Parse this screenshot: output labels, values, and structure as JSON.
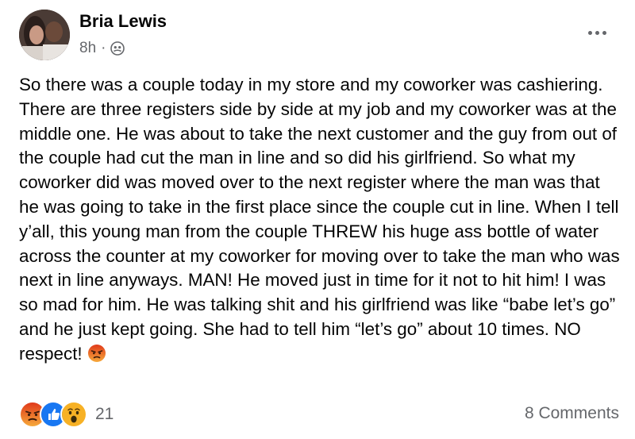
{
  "post": {
    "author": "Bria Lewis",
    "time": "8h",
    "separator": "·",
    "audience_icon": "friends-icon",
    "more_icon": "more-dots-icon",
    "body": "So there was a couple today in my store and my coworker was cashiering. There are three registers side by side at my job and my coworker was at the middle one. He was about to take the next customer and the guy from out of the couple had cut the man in line and so did his girlfriend. So what my coworker did was moved over to the next register where the man was that he was going to take in the first place since the couple cut in line. When I tell y’all, this young man from the couple THREW his huge ass bottle of water across the counter at my coworker for moving over to take the man who was next in line anyways. MAN! He moved just in time for it not to hit him! I was so mad for him. He was talking shit and his girlfriend was like “babe let’s go” and he just kept going. She had to tell him “let’s go” about 10 times. NO respect!",
    "body_emoji": "angry-face-icon"
  },
  "footer": {
    "reactions": [
      "angry-reaction-icon",
      "like-reaction-icon",
      "wow-reaction-icon"
    ],
    "reaction_count": "21",
    "comments": "8 Comments"
  },
  "colors": {
    "text": "#050505",
    "secondary": "#65676b",
    "like_blue": "#1877f2",
    "angry_orange": "#e9710f",
    "wow_yellow": "#f7b125"
  }
}
